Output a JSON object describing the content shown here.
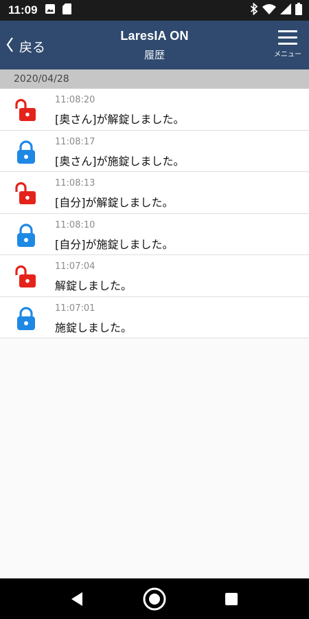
{
  "status_bar": {
    "time": "11:09",
    "left_icons": [
      "image-icon",
      "sim-card-icon"
    ],
    "right_icons": [
      "bluetooth-icon",
      "wifi-icon",
      "signal-icon",
      "battery-icon"
    ]
  },
  "header": {
    "back_label": "戻る",
    "title": "LaresIA ON",
    "subtitle": "履歴",
    "menu_label": "メニュー"
  },
  "history": {
    "date": "2020/04/28",
    "entries": [
      {
        "time": "11:08:20",
        "message": "[奥さん]が解錠しました。",
        "state": "unlocked",
        "icon": "lock-open-icon"
      },
      {
        "time": "11:08:17",
        "message": "[奥さん]が施錠しました。",
        "state": "locked",
        "icon": "lock-closed-icon"
      },
      {
        "time": "11:08:13",
        "message": "[自分]が解錠しました。",
        "state": "unlocked",
        "icon": "lock-open-icon"
      },
      {
        "time": "11:08:10",
        "message": "[自分]が施錠しました。",
        "state": "locked",
        "icon": "lock-closed-icon"
      },
      {
        "time": "11:07:04",
        "message": "解錠しました。",
        "state": "unlocked",
        "icon": "lock-open-icon"
      },
      {
        "time": "11:07:01",
        "message": "施錠しました。",
        "state": "locked",
        "icon": "lock-closed-icon"
      }
    ]
  },
  "colors": {
    "header_bg": "#2f4a6e",
    "unlocked": "#e5231b",
    "locked": "#1e88e5",
    "date_bar": "#c6c6c6"
  },
  "navigation_bar": {
    "icons": [
      "back-triangle-icon",
      "home-circle-icon",
      "recents-square-icon"
    ]
  }
}
